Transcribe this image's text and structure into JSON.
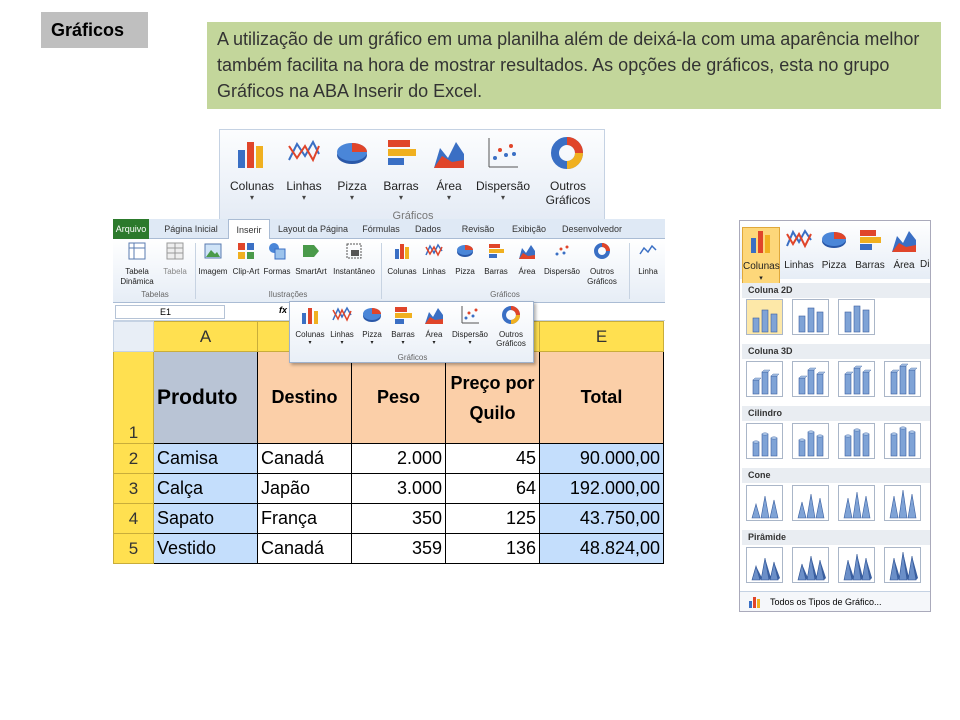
{
  "title": "Gráficos",
  "description": "A utilização de um gráfico em uma planilha além de deixá-la com uma aparência melhor também facilita na hora de mostrar resultados. As opções de gráficos, esta no grupo Gráficos na ABA Inserir do Excel.",
  "big_ribbon": {
    "items": [
      "Colunas",
      "Linhas",
      "Pizza",
      "Barras",
      "Área",
      "Dispersão",
      "Outros Gráficos"
    ],
    "group": "Gráficos"
  },
  "excel": {
    "tabs": [
      "Arquivo",
      "Página Inicial",
      "Inserir",
      "Layout da Página",
      "Fórmulas",
      "Dados",
      "Revisão",
      "Exibição",
      "Desenvolvedor"
    ],
    "ribbon_items": {
      "tabela_dinamica": "Tabela Dinâmica",
      "tabela": "Tabela",
      "imagem": "Imagem",
      "clipart": "Clip-Art",
      "formas": "Formas",
      "smartart": "SmartArt",
      "instantaneo": "Instantâneo",
      "colunas": "Colunas",
      "linhas": "Linhas",
      "pizza": "Pizza",
      "barras": "Barras",
      "area": "Área",
      "dispersao": "Dispersão",
      "outros": "Outros Gráficos",
      "linha": "Linha"
    },
    "groups": {
      "tabelas": "Tabelas",
      "ilustracoes": "Ilustrações",
      "graficos": "Gráficos"
    },
    "namebox": "E1",
    "fx": "fx",
    "col_a": "A",
    "col_e": "E",
    "headers": {
      "produto": "Produto",
      "destino": "Destino",
      "peso": "Peso",
      "preco": "Preço por Quilo",
      "total": "Total"
    },
    "rows": [
      {
        "n": "1"
      },
      {
        "n": "2",
        "produto": "Camisa",
        "destino": "Canadá",
        "peso": "2.000",
        "preco": "45",
        "total": "90.000,00"
      },
      {
        "n": "3",
        "produto": "Calça",
        "destino": "Japão",
        "peso": "3.000",
        "preco": "64",
        "total": "192.000,00"
      },
      {
        "n": "4",
        "produto": "Sapato",
        "destino": "França",
        "peso": "350",
        "preco": "125",
        "total": "43.750,00"
      },
      {
        "n": "5",
        "produto": "Vestido",
        "destino": "Canadá",
        "peso": "359",
        "preco": "136",
        "total": "48.824,00"
      }
    ]
  },
  "mini_ribbon": {
    "items": [
      "Colunas",
      "Linhas",
      "Pizza",
      "Barras",
      "Área",
      "Dispersão",
      "Outros Gráficos"
    ],
    "group": "Gráficos"
  },
  "dropdown": {
    "items": [
      "Colunas",
      "Linhas",
      "Pizza",
      "Barras",
      "Área",
      "Di"
    ],
    "sections": [
      "Coluna 2D",
      "Coluna 3D",
      "Cilindro",
      "Cone",
      "Pirâmide"
    ],
    "footer": "Todos os Tipos de Gráfico..."
  }
}
